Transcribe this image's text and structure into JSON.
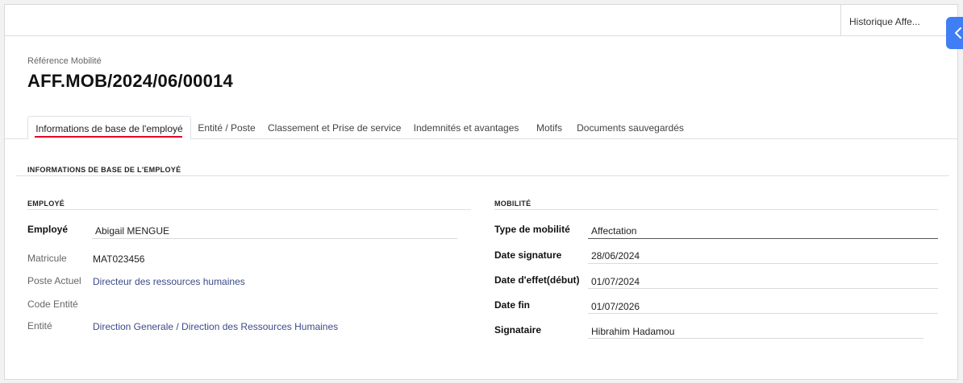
{
  "smart_button": {
    "label": "Historique Affe..."
  },
  "reference": {
    "label": "Référence Mobilité",
    "value": "AFF.MOB/2024/06/00014"
  },
  "tabs": [
    {
      "label": "Informations de base de l'employé",
      "active": true
    },
    {
      "label": "Entité / Poste"
    },
    {
      "label": "Classement et Prise de service"
    },
    {
      "label": "Indemnités et avantages"
    },
    {
      "label": "Motifs"
    },
    {
      "label": "Documents sauvegardés"
    }
  ],
  "section": {
    "title": "INFORMATIONS DE BASE DE L'EMPLOYÉ"
  },
  "employee_group": {
    "title": "EMPLOYÉ",
    "fields": [
      {
        "label": "Employé",
        "value": "Abigail MENGUE"
      },
      {
        "label": "Matricule",
        "value": "MAT023456"
      },
      {
        "label": "Poste Actuel",
        "value": "Directeur des ressources humaines"
      },
      {
        "label": "Code Entité",
        "value": ""
      },
      {
        "label": "Entité",
        "value": "Direction Generale / Direction des Ressources Humaines"
      }
    ]
  },
  "mobility_group": {
    "title": "MOBILITÉ",
    "fields": [
      {
        "label": "Type de mobilité",
        "value": "Affectation"
      },
      {
        "label": "Date signature",
        "value": "28/06/2024"
      },
      {
        "label": "Date d'effet(début)",
        "value": "01/07/2024"
      },
      {
        "label": "Date fin",
        "value": "01/07/2026"
      },
      {
        "label": "Signataire",
        "value": "Hibrahim Hadamou"
      }
    ]
  },
  "colors": {
    "accent_underline": "#e4002b",
    "toggle": "#3f7ef5",
    "link": "#3d4a8a"
  },
  "icons": {
    "side_toggle": "chevron-left-icon"
  }
}
